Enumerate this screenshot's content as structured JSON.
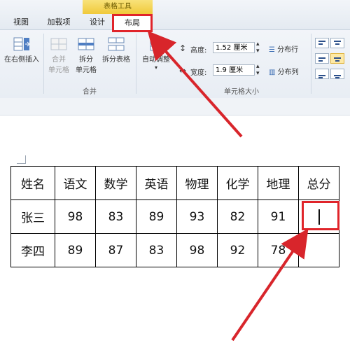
{
  "ribbon": {
    "context_header": "表格工具",
    "tabs": [
      {
        "label": "视图"
      },
      {
        "label": "加载项"
      },
      {
        "label": "设计"
      },
      {
        "label": "布局"
      }
    ],
    "buttons": {
      "insert_right": "在右侧插入",
      "merge_cells_line1": "合并",
      "merge_cells_line2": "单元格",
      "split_cells_line1": "拆分",
      "split_cells_line2": "单元格",
      "split_table": "拆分表格",
      "autofit": "自动调整",
      "distribute_rows": "分布行",
      "distribute_cols": "分布列"
    },
    "fields": {
      "height_label": "高度:",
      "height_value": "1.52 厘米",
      "width_label": "宽度:",
      "width_value": "1.9 厘米"
    },
    "groups": {
      "merge": "合并",
      "cell_size": "单元格大小"
    }
  },
  "table": {
    "rows": [
      [
        "姓名",
        "语文",
        "数学",
        "英语",
        "物理",
        "化学",
        "地理",
        "总分"
      ],
      [
        "张三",
        "98",
        "83",
        "89",
        "93",
        "82",
        "91",
        ""
      ],
      [
        "李四",
        "89",
        "87",
        "83",
        "98",
        "92",
        "78",
        ""
      ]
    ]
  },
  "colors": {
    "highlight": "#e0242a",
    "context_tab": "#f0c93a"
  }
}
